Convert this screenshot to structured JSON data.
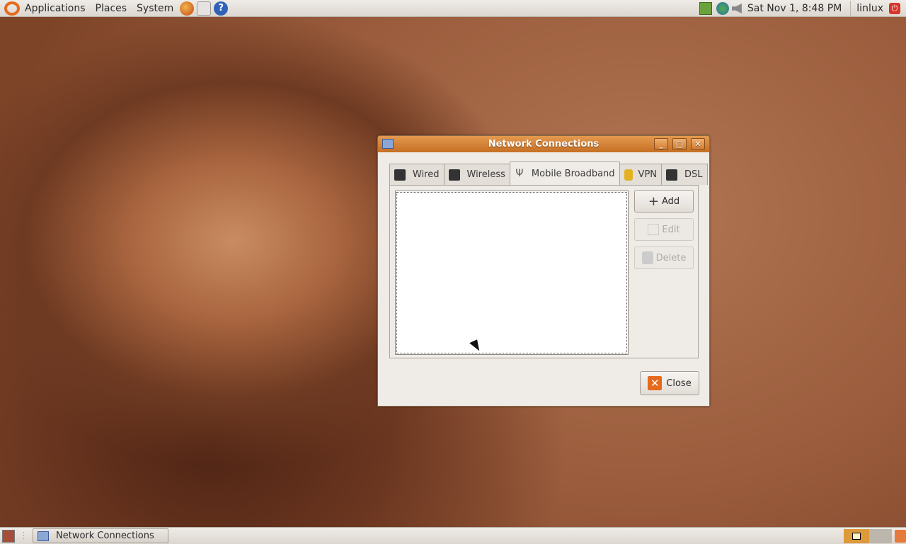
{
  "top_panel": {
    "menus": [
      "Applications",
      "Places",
      "System"
    ],
    "launchers": [
      "firefox-icon",
      "mail-icon",
      "help-icon"
    ],
    "clock": "Sat Nov  1,  8:48 PM",
    "user": "linlux"
  },
  "window": {
    "title": "Network Connections",
    "tabs": [
      {
        "label": "Wired",
        "icon": "wired-icon"
      },
      {
        "label": "Wireless",
        "icon": "wireless-icon"
      },
      {
        "label": "Mobile Broadband",
        "icon": "antenna-icon"
      },
      {
        "label": "VPN",
        "icon": "lock-icon"
      },
      {
        "label": "DSL",
        "icon": "dsl-icon"
      }
    ],
    "active_tab": "Mobile Broadband",
    "buttons": {
      "add": "Add",
      "edit": "Edit",
      "delete": "Delete",
      "close": "Close"
    },
    "connections": []
  },
  "bottom_panel": {
    "task": "Network Connections"
  },
  "colors": {
    "accent": "#e0883a",
    "close_icon": "#e66a1e"
  }
}
